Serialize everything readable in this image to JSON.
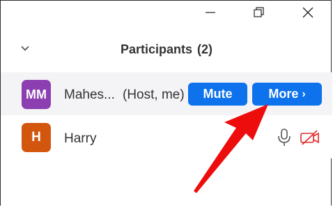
{
  "window": {
    "controls": [
      "minimize-icon",
      "restore-icon",
      "close-icon"
    ]
  },
  "panel": {
    "title": "Participants",
    "count_label": "(2)"
  },
  "participants": [
    {
      "initials": "MM",
      "name": "Mahes...",
      "role": "(Host, me)",
      "avatar_color": "#8b3fb0",
      "mute_label": "Mute",
      "more_label": "More"
    },
    {
      "initials": "H",
      "name": "Harry",
      "avatar_color": "#d3560f",
      "mic_icon": "microphone-icon",
      "video_icon": "video-off-icon"
    }
  ],
  "colors": {
    "accent": "#0e72ed",
    "highlight_row": "#f4f4f6",
    "video_off": "#e02828",
    "annotation_arrow": "#ee0d0d"
  }
}
